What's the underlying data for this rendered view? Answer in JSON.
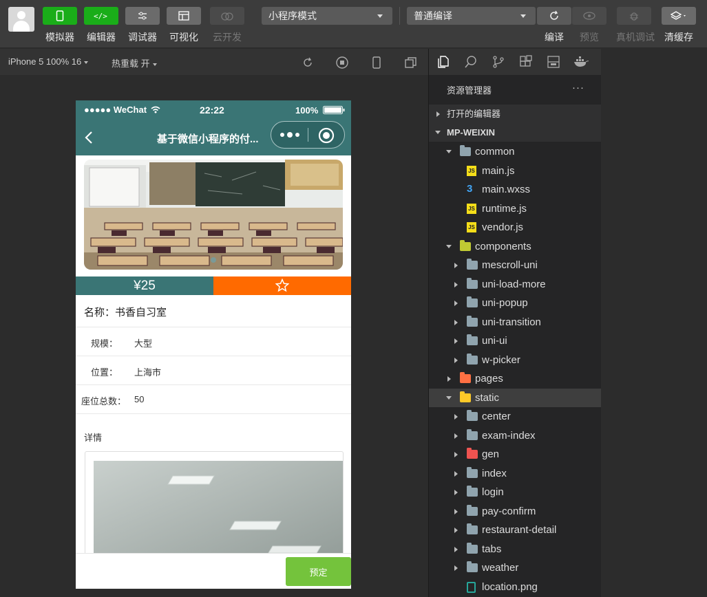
{
  "toolbar": {
    "buttons": [
      {
        "label": "模拟器"
      },
      {
        "label": "编辑器"
      },
      {
        "label": "调试器"
      },
      {
        "label": "可视化"
      },
      {
        "label": "云开发"
      }
    ],
    "mode_select": "小程序模式",
    "compile_select": "普通编译",
    "right_buttons": [
      {
        "label": "编译"
      },
      {
        "label": "预览"
      },
      {
        "label": "真机调试"
      },
      {
        "label": "清缓存"
      }
    ]
  },
  "subbar": {
    "device": "iPhone 5 100% 16",
    "hotreload": "热重载 开"
  },
  "phone": {
    "status": {
      "carrier": "●●●●● WeChat",
      "time": "22:22",
      "battery": "100%"
    },
    "nav_title": "基于微信小程序的付...",
    "price": "¥25",
    "name_row": "名称：书香自习室",
    "rows": [
      {
        "label": "规模：",
        "value": "大型"
      },
      {
        "label": "位置：",
        "value": "上海市"
      },
      {
        "label": "座位总数：",
        "value": "50"
      }
    ],
    "detail_label": "详情",
    "book_button": "预定"
  },
  "explorer": {
    "title": "资源管理器",
    "more": "···",
    "open_editors": "打开的编辑器",
    "project": "MP-WEIXIN",
    "items": [
      {
        "name": "common",
        "depth": 1,
        "type": "folder-open",
        "expanded": true
      },
      {
        "name": "main.js",
        "depth": 2,
        "type": "js"
      },
      {
        "name": "main.wxss",
        "depth": 2,
        "type": "css"
      },
      {
        "name": "runtime.js",
        "depth": 2,
        "type": "js"
      },
      {
        "name": "vendor.js",
        "depth": 2,
        "type": "js"
      },
      {
        "name": "components",
        "depth": 1,
        "type": "folder-components",
        "expanded": true
      },
      {
        "name": "mescroll-uni",
        "depth": 2,
        "type": "folder"
      },
      {
        "name": "uni-load-more",
        "depth": 2,
        "type": "folder"
      },
      {
        "name": "uni-popup",
        "depth": 2,
        "type": "folder"
      },
      {
        "name": "uni-transition",
        "depth": 2,
        "type": "folder"
      },
      {
        "name": "uni-ui",
        "depth": 2,
        "type": "folder"
      },
      {
        "name": "w-picker",
        "depth": 2,
        "type": "folder"
      },
      {
        "name": "pages",
        "depth": 1,
        "type": "folder-pages"
      },
      {
        "name": "static",
        "depth": 1,
        "type": "folder-static",
        "expanded": true,
        "active": true
      },
      {
        "name": "center",
        "depth": 2,
        "type": "folder"
      },
      {
        "name": "exam-index",
        "depth": 2,
        "type": "folder"
      },
      {
        "name": "gen",
        "depth": 2,
        "type": "folder-gen"
      },
      {
        "name": "index",
        "depth": 2,
        "type": "folder"
      },
      {
        "name": "login",
        "depth": 2,
        "type": "folder"
      },
      {
        "name": "pay-confirm",
        "depth": 2,
        "type": "folder"
      },
      {
        "name": "restaurant-detail",
        "depth": 2,
        "type": "folder"
      },
      {
        "name": "tabs",
        "depth": 2,
        "type": "folder"
      },
      {
        "name": "weather",
        "depth": 2,
        "type": "folder"
      },
      {
        "name": "location.png",
        "depth": 2,
        "type": "image"
      }
    ]
  },
  "colors": {
    "accent_green": "#1aad19",
    "nav_teal": "#3a7575",
    "orange": "#ff6a00",
    "book_green": "#74c33c"
  }
}
